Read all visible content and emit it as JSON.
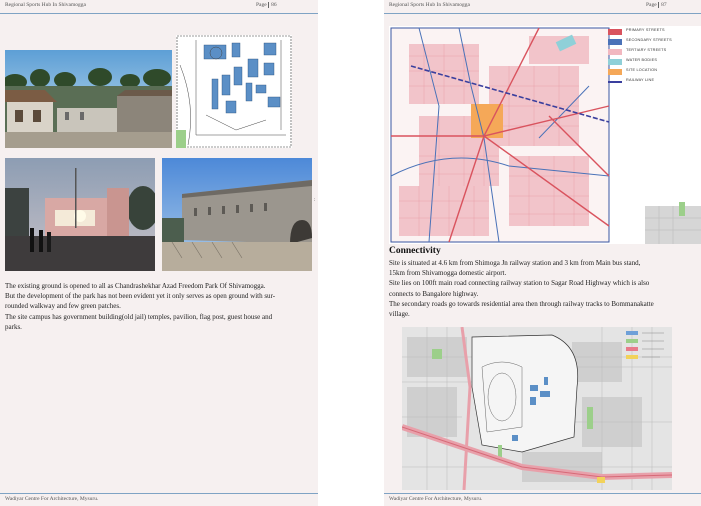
{
  "left_page": {
    "header_title": "Regional Sports Hub In Shivamogga",
    "page_label": "Page",
    "page_number": "86",
    "paragraph": [
      "The existing ground is opened to all as Chandrashekhar Azad Freedom Park Of Shivamogga.",
      "But the development of the park has not been evident yet it only serves as open ground with sur-",
      "rounded walkway and few green patches.",
      "The site campus has government building(old jail) temples, pavilion, flag post, guest house and",
      "parks."
    ],
    "footer": "Wadiyar Centre For Architecture, Mysuru."
  },
  "right_page": {
    "header_title": "Regional Sports Hub In Shivamogga",
    "page_label": "Page",
    "page_number": "87",
    "map_legend": [
      {
        "label": "PRIMARY STREETS",
        "color": "#d9535e"
      },
      {
        "label": "SECONDARY STREETS",
        "color": "#4a72b8"
      },
      {
        "label": "TERTIARY STREETS",
        "color": "#f2b8c0"
      },
      {
        "label": "WATER BODIES",
        "color": "#8fd0d8"
      },
      {
        "label": "SITE LOCATION",
        "color": "#f5a858"
      },
      {
        "label": "RAILWAY LINE",
        "color": "#3a3f9e"
      }
    ],
    "section_heading": "Connectivity",
    "paragraph": [
      "Site is situated at 4.6 km from Shimoga Jn railway station and 3 km from Main bus stand,",
      "15km from Shivamogga domestic airport.",
      "Site lies on 100ft main road connecting railway station to Sagar Road Highway which is also",
      "connects to Bangalore highway.",
      "The secondary roads go towards residential area then through railway tracks to Bommanakatte",
      "village."
    ],
    "footer": "Wadiyar Centre For Architecture, Mysuru."
  }
}
